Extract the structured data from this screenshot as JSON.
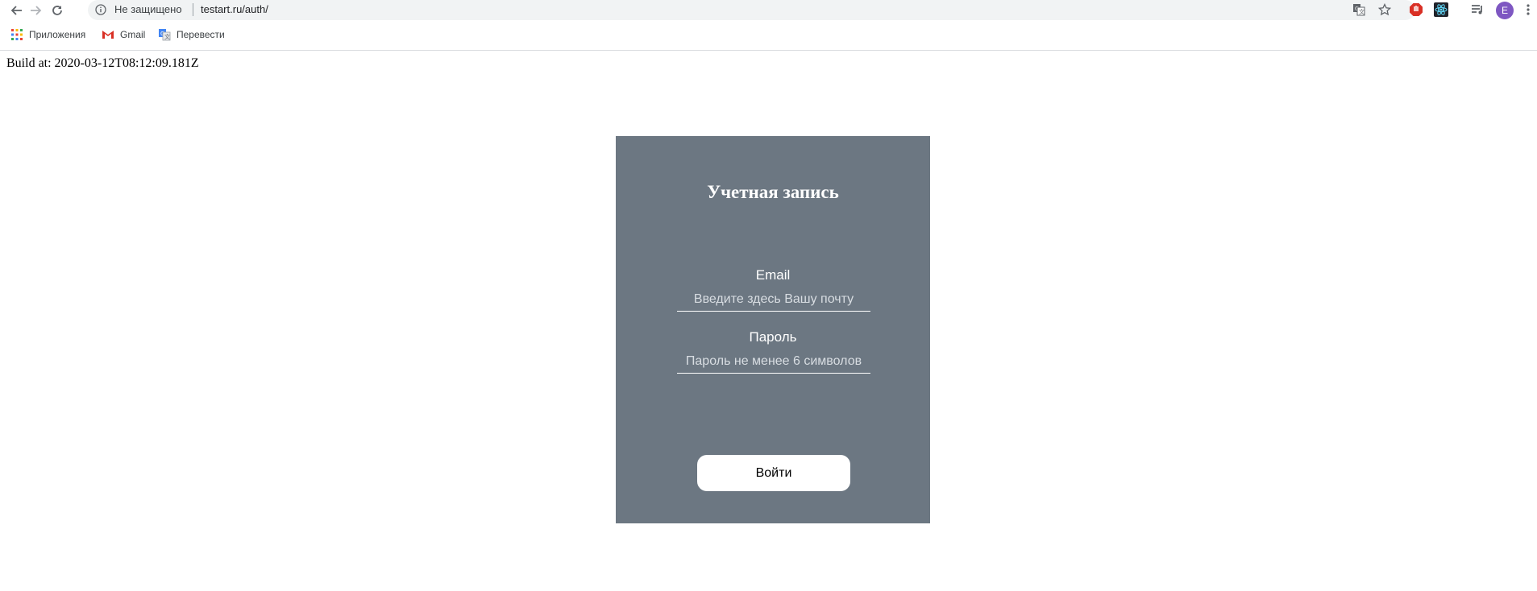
{
  "browser": {
    "security_text": "Не защищено",
    "url": "testart.ru/auth/",
    "avatar_letter": "E",
    "bookmarks": [
      {
        "label": "Приложения",
        "icon": "apps-grid-icon"
      },
      {
        "label": "Gmail",
        "icon": "gmail-icon"
      },
      {
        "label": "Перевести",
        "icon": "translate-icon"
      }
    ],
    "icons": [
      "back-arrow-icon",
      "forward-arrow-icon",
      "reload-icon",
      "info-icon",
      "translate-page-icon",
      "bookmark-star-icon",
      "adblock-extension-icon",
      "react-devtools-icon",
      "media-queue-icon",
      "account-avatar",
      "kebab-menu-icon"
    ]
  },
  "page": {
    "build_text": "Build at: 2020-03-12T08:12:09.181Z"
  },
  "auth": {
    "title": "Учетная запись",
    "email_label": "Email",
    "email_placeholder": "Введите здесь Вашу почту",
    "email_value": "",
    "password_label": "Пароль",
    "password_placeholder": "Пароль не менее 6 символов",
    "password_value": "",
    "login_button": "Войти"
  },
  "colors": {
    "card_background": "#6c7782",
    "button_background": "#ffffff",
    "text_on_card": "#ffffff",
    "avatar": "#7e57c2"
  }
}
